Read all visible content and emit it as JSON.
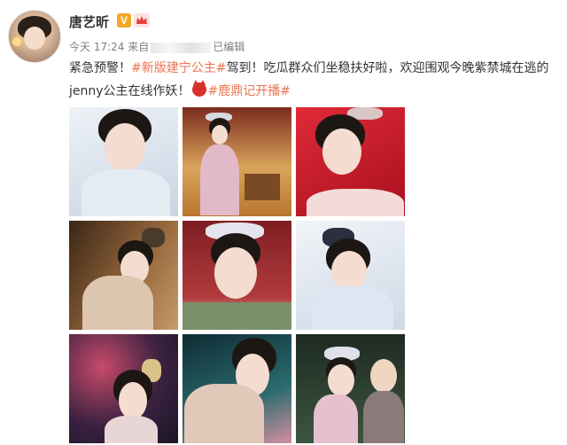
{
  "post": {
    "author": "唐艺昕",
    "vip_badge": "V",
    "time": "今天 17:24",
    "source_prefix": "来自",
    "edited": "已编辑",
    "text_part1": "紧急预警！",
    "hashtag1": "#新版建宁公主#",
    "text_part2": "驾到！吃瓜群众们坐稳扶好啦，欢迎围观今晚紫禁城在逃的jenny公主在线作妖！",
    "hashtag2": "#鹿鼎记开播#"
  },
  "photos": [
    {
      "icon": "portrait-photo",
      "bg": "#dfe6ee"
    },
    {
      "icon": "portrait-photo",
      "bg": "#c98f4e"
    },
    {
      "icon": "portrait-photo",
      "bg": "#c41b2c"
    },
    {
      "icon": "portrait-photo",
      "bg": "#6b4a2e"
    },
    {
      "icon": "portrait-photo",
      "bg": "#9b2d2e"
    },
    {
      "icon": "portrait-photo",
      "bg": "#dfe6f0"
    },
    {
      "icon": "portrait-photo",
      "bg": "#2a2a3e"
    },
    {
      "icon": "portrait-photo",
      "bg": "#1e4d52"
    },
    {
      "icon": "portrait-photo",
      "bg": "#3a4a3a"
    }
  ]
}
